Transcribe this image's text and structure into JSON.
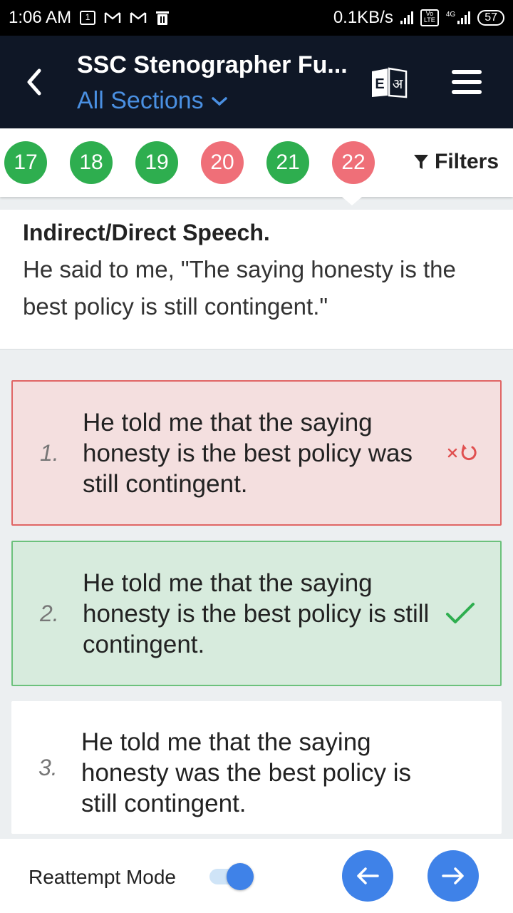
{
  "status_bar": {
    "time": "1:06 AM",
    "notification_box": "1",
    "net_speed": "0.1KB/s",
    "volte": "Vo LTE",
    "network": "4G",
    "battery": "57"
  },
  "header": {
    "title": "SSC Stenographer Fu...",
    "section_selector": "All Sections",
    "lang_toggle_en": "E",
    "lang_toggle_hi": "अ"
  },
  "question_nav": {
    "items": [
      {
        "number": "17",
        "status": "correct"
      },
      {
        "number": "18",
        "status": "correct"
      },
      {
        "number": "19",
        "status": "correct"
      },
      {
        "number": "20",
        "status": "incorrect"
      },
      {
        "number": "21",
        "status": "correct"
      },
      {
        "number": "22",
        "status": "incorrect"
      }
    ],
    "filters_label": "Filters"
  },
  "question": {
    "heading": "Indirect/Direct Speech.",
    "text": "He said to me, \"The saying honesty is the best policy is still contingent.\""
  },
  "options": [
    {
      "number": "1.",
      "text": "He told me that the saying honesty is the best policy was still contingent.",
      "state": "wrong"
    },
    {
      "number": "2.",
      "text": "He told me that the saying honesty is the best policy is still contingent.",
      "state": "correct"
    },
    {
      "number": "3.",
      "text": "He told me that the saying honesty was the best policy is still contingent.",
      "state": "neutral"
    }
  ],
  "bottom_bar": {
    "reattempt_label": "Reattempt Mode",
    "reattempt_enabled": true
  },
  "colors": {
    "header_bg": "#0f1726",
    "accent_blue": "#3f82e8",
    "correct_green": "#2eae4f",
    "incorrect_red": "#ef6f78"
  }
}
